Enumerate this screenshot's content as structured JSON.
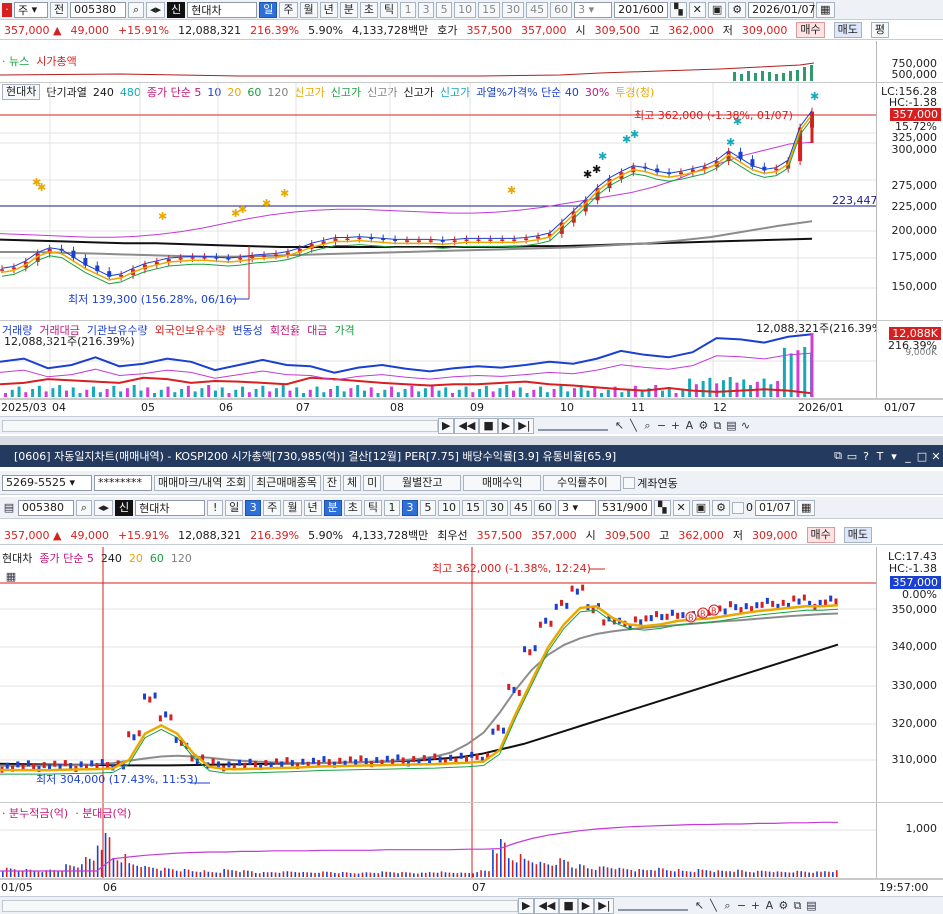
{
  "top": {
    "toolbar": {
      "period_type": "주",
      "scope": "전",
      "code": "005380",
      "stock_badge": "신",
      "stock_name": "현대차",
      "periods": [
        "일",
        "주",
        "월",
        "년",
        "분",
        "초",
        "틱"
      ],
      "numbers": [
        "1",
        "3",
        "5",
        "10",
        "15",
        "30",
        "45",
        "60"
      ],
      "interval": "3",
      "count": "201/600",
      "date": "2026/01/07"
    },
    "quote": {
      "price": "357,000",
      "change": "49,000",
      "pct": "+15.91%",
      "volume": "12,088,321",
      "vol_ratio": "216.39%",
      "turnover": "5.90%",
      "amount": "4,133,728백만",
      "ask_label": "호가",
      "ask1": "357,500",
      "ask2": "357,000",
      "open_label": "시",
      "open": "309,500",
      "high_label": "고",
      "high": "362,000",
      "low_label": "저",
      "low": "309,000",
      "buy": "매수",
      "sell": "매도",
      "eval": "평"
    },
    "news_legend": [
      "뉴스",
      "시가총액"
    ],
    "news_axis": [
      "750,000",
      "500,000"
    ],
    "price_legend": {
      "name": "현대차",
      "items": [
        {
          "text": "단기과열",
          "color": "#1a1a1a"
        },
        {
          "text": "240",
          "color": "#1a1a1a"
        },
        {
          "text": "480",
          "color": "#18a8b8"
        },
        {
          "text": "종가 단순 5",
          "color": "#c0157a"
        },
        {
          "text": "10",
          "color": "#1a3fd1"
        },
        {
          "text": "20",
          "color": "#e8a900"
        },
        {
          "text": "60",
          "color": "#18a040"
        },
        {
          "text": "120",
          "color": "#808080"
        },
        {
          "text": "신고가",
          "color": "#e8a900"
        },
        {
          "text": "신고가",
          "color": "#18a040"
        },
        {
          "text": "신고가",
          "color": "#808080"
        },
        {
          "text": "신고가",
          "color": "#1a1a1a"
        },
        {
          "text": "신고가",
          "color": "#18a8b8"
        },
        {
          "text": "과열%가격% 단순 40",
          "color": "#1a3fd1"
        },
        {
          "text": "30%",
          "color": "#c0157a"
        },
        {
          "text": "투경(청)",
          "color": "#e8a900"
        }
      ]
    },
    "price_axis": [
      "325,000",
      "300,000",
      "275,000",
      "250,000",
      "225,000",
      "200,000",
      "175,000",
      "150,000"
    ],
    "price_tags": {
      "lc": "LC:156.28",
      "hc": "HC:-1.38",
      "last": "357,000",
      "pct": "15.72%",
      "ref": "223,447"
    },
    "high_note": "최고 362,000 (-1.38%, 01/07)",
    "low_note": "최저 139,300 (156.28%, 06/16)",
    "volume_legend": [
      {
        "text": "거래량",
        "color": "#1a3fd1"
      },
      {
        "text": "거래대금",
        "color": "#c0157a"
      },
      {
        "text": "기관보유수량",
        "color": "#1a3fd1"
      },
      {
        "text": "외국인보유수량",
        "color": "#d71f1f"
      },
      {
        "text": "변동성",
        "color": "#1a3fd1"
      },
      {
        "text": "회전율",
        "color": "#c0157a"
      },
      {
        "text": "대금",
        "color": "#c0157a"
      },
      {
        "text": "가격",
        "color": "#18a040"
      }
    ],
    "volume_note_left": "12,088,321주(216.39%)",
    "volume_note_right": "12,088,321주(216.39%)",
    "volume_tags": {
      "a": "12,088K",
      "b": "216.39%",
      "c": "9,000K"
    },
    "x_labels": [
      "2025/03",
      "04",
      "05",
      "06",
      "07",
      "08",
      "09",
      "10",
      "11",
      "12",
      "2026/01",
      "01/07"
    ],
    "series": {
      "daily_close": [
        188000,
        190000,
        196000,
        205000,
        210000,
        208000,
        200000,
        192000,
        186000,
        180000,
        182000,
        188000,
        193000,
        196000,
        199000,
        200000,
        201000,
        201000,
        200000,
        199000,
        200000,
        202000,
        203000,
        204000,
        206000,
        210000,
        215000,
        218000,
        221000,
        221000,
        222000,
        221000,
        220000,
        219000,
        219000,
        219000,
        219000,
        218000,
        219000,
        220000,
        220000,
        220000,
        220000,
        220000,
        221000,
        223000,
        226000,
        238000,
        250000,
        262000,
        275000,
        285000,
        292000,
        298000,
        296000,
        292000,
        290000,
        292000,
        295000,
        298000,
        304000,
        314000,
        306000,
        298000,
        294000,
        296000,
        304000,
        340000,
        357000
      ],
      "ma_upper": [
        222000,
        221000,
        220000,
        219000,
        218000,
        218000,
        219000,
        221000,
        224000,
        228000,
        233000,
        238000,
        242000,
        245000,
        247000,
        248000,
        248000,
        247000,
        246000,
        245000,
        244000,
        244000,
        245000,
        247000,
        250000,
        254000,
        258000,
        262000,
        266000,
        272000,
        280000,
        290000,
        298000,
        306000,
        312000,
        318000,
        320000
      ],
      "ma_black": [
        222000,
        221000,
        220000,
        219000,
        218000,
        218000,
        217000,
        216000,
        215000,
        214000,
        214000,
        214000,
        214000,
        214000,
        214000,
        214000,
        214000,
        215000,
        215000,
        216000,
        217000,
        218000,
        219000,
        220000,
        221000,
        222000,
        223000
      ],
      "ma_gray": [
        213000,
        213000,
        212000,
        211000,
        210000,
        209000,
        208000,
        208000,
        209000,
        210000,
        211000,
        212000,
        213000,
        214000,
        215000,
        216000,
        217000,
        218000,
        220000,
        222000,
        225000,
        229000,
        235000,
        241000,
        246000
      ],
      "vol_blue": [
        0.55,
        0.6,
        0.45,
        0.5,
        0.62,
        0.48,
        0.52,
        0.6,
        0.55,
        0.42,
        0.5,
        0.58,
        0.5,
        0.48,
        0.38,
        0.46,
        0.5,
        0.44,
        0.4,
        0.45,
        0.48,
        0.46,
        0.5,
        0.55,
        0.52,
        0.6,
        0.72,
        0.66,
        0.62,
        0.7,
        0.92,
        0.9,
        0.85,
        0.94,
        0.98
      ],
      "vol_red": [
        0.2,
        0.22,
        0.28,
        0.26,
        0.24,
        0.22,
        0.3,
        0.28,
        0.22,
        0.25,
        0.24,
        0.22,
        0.2,
        0.3,
        0.28,
        0.25,
        0.22,
        0.2,
        0.18,
        0.2,
        0.2,
        0.22,
        0.24,
        0.2,
        0.18,
        0.15,
        0.12,
        0.1,
        0.14,
        0.1,
        0.08,
        0.1,
        0.12,
        0.1,
        0.06
      ]
    }
  },
  "bottom": {
    "title": "[0606] 자동일지차트(매매내역) - KOSPI200 시가총액[730,985(억)] 결산[12월] PER[7.75] 배당수익률[3.9] 유통비율[65.9]",
    "toolbar": {
      "account": "5269-5525",
      "password": "********",
      "btn1": "매매마크/내역 조회",
      "btn2": "최근매매종목",
      "chk": [
        "잔",
        "체",
        "미"
      ],
      "btn3": "월별잔고",
      "btn4": "매매수익",
      "btn5": "수익률추이",
      "link_label": "계좌연동"
    },
    "toolbar2": {
      "code": "005380",
      "stock_badge": "신",
      "stock_name": "현대차",
      "excl": "!",
      "periods": [
        "일",
        "3",
        "주",
        "월",
        "년",
        "분",
        "초",
        "틱"
      ],
      "numbers": [
        "1",
        "3",
        "5",
        "10",
        "15",
        "30",
        "45",
        "60"
      ],
      "interval": "3",
      "count": "531/900",
      "zero": "0",
      "date": "01/07"
    },
    "quote": {
      "price": "357,000",
      "change": "49,000",
      "pct": "+15.91%",
      "volume": "12,088,321",
      "vol_ratio": "216.39%",
      "turnover": "5.90%",
      "amount": "4,133,728백만",
      "ask_label": "최우선",
      "ask1": "357,500",
      "ask2": "357,000",
      "open_label": "시",
      "open": "309,500",
      "high_label": "고",
      "high": "362,000",
      "low_label": "저",
      "low": "309,000",
      "buy": "매수",
      "sell": "매도"
    },
    "legend": [
      {
        "text": "현대차",
        "color": "#1a1a1a"
      },
      {
        "text": "종가 단순 5",
        "color": "#c0157a"
      },
      {
        "text": "240",
        "color": "#1a1a1a"
      },
      {
        "text": "20",
        "color": "#e8a900"
      },
      {
        "text": "60",
        "color": "#18a040"
      },
      {
        "text": "120",
        "color": "#808080"
      }
    ],
    "price_axis": [
      "350,000",
      "340,000",
      "330,000",
      "320,000",
      "310,000"
    ],
    "tags": {
      "lc": "LC:17.43",
      "hc": "HC:-1.38",
      "last": "357,000",
      "pct": "0.00%"
    },
    "high_note": "최고 362,000 (-1.38%, 12:24)",
    "low_note": "최저 304,000 (17.43%, 11:53)",
    "volume_legend": [
      "분누적금(억)",
      "분대금(억)"
    ],
    "volume_axis": [
      "1,000"
    ],
    "x_labels": [
      "01/05",
      "06",
      "07",
      "19:57:00"
    ],
    "series": {
      "intraday_close": [
        306800,
        306900,
        307000,
        307100,
        307000,
        307200,
        307300,
        307500,
        316000,
        328000,
        322000,
        314000,
        309000,
        307500,
        307200,
        307400,
        307600,
        307800,
        307900,
        308000,
        308200,
        308300,
        308400,
        308500,
        308600,
        308700,
        308800,
        309000,
        309200,
        309500,
        309800,
        318000,
        330000,
        342000,
        350000,
        356000,
        360000,
        355000,
        351000,
        350000,
        351000,
        352000,
        353000,
        352000,
        353000,
        354000,
        355000,
        355000,
        356000,
        356000,
        357000,
        356000,
        357000
      ],
      "ma_yellow": [
        307000,
        307000,
        307000,
        307000,
        307100,
        307200,
        307300,
        307500,
        310000,
        318000,
        320500,
        318000,
        312000,
        308000,
        307300,
        307300,
        307400,
        307600,
        307700,
        307900,
        308100,
        308200,
        308300,
        308400,
        308500,
        308600,
        308700,
        308800,
        309000,
        309200,
        309600,
        313000,
        324000,
        334000,
        344000,
        351000,
        356000,
        356500,
        353000,
        351000,
        350500,
        351000,
        352000,
        352500,
        352800,
        353500,
        354300,
        355000,
        355500,
        356000,
        356500,
        356500,
        356800
      ],
      "ma_black": [
        308000,
        307900,
        307800,
        307700,
        307700,
        307600,
        307500,
        307500,
        307500,
        307600,
        307700,
        307800,
        307900,
        308000,
        308100,
        308200,
        308300,
        308400,
        308600,
        308800,
        309000,
        309500,
        310000,
        311000,
        312500,
        314000,
        316000,
        318000,
        320000,
        322000,
        324000,
        326000,
        328000,
        330000,
        332000,
        334000,
        336000,
        338000,
        340000,
        342000,
        344000
      ],
      "ma_gray": [
        308000,
        308000,
        308000,
        308100,
        308100,
        308200,
        308400,
        308800,
        309500,
        310200,
        310800,
        311000,
        310800,
        310400,
        309900,
        309500,
        309200,
        309000,
        308900,
        308800,
        308800,
        308900,
        309000,
        309200,
        309400,
        309700,
        310100,
        310800,
        312000,
        314500,
        318000,
        324000,
        331000,
        337000,
        341500,
        344500,
        346500,
        347800,
        348600,
        349200,
        349700,
        350100,
        350500,
        350900,
        351300,
        351700,
        352000,
        352400,
        352800,
        353200,
        353500,
        353800,
        354000
      ],
      "bars": [
        0.12,
        0.1,
        0.08,
        0.1,
        0.18,
        0.3,
        0.7,
        0.35,
        0.22,
        0.15,
        0.12,
        0.1,
        0.08,
        0.06,
        0.1,
        0.08,
        0.05,
        0.06,
        0.07,
        0.05,
        0.06,
        0.05,
        0.04,
        0.05,
        0.06,
        0.05,
        0.04,
        0.06,
        0.05,
        0.04,
        0.08,
        0.6,
        0.35,
        0.3,
        0.22,
        0.28,
        0.18,
        0.14,
        0.16,
        0.12,
        0.1,
        0.12,
        0.1,
        0.08,
        0.1,
        0.08,
        0.09,
        0.07,
        0.08,
        0.06,
        0.07,
        0.06,
        0.08
      ],
      "cum_line": [
        0.0,
        0.0,
        0.0,
        0.0,
        0.0,
        0.0,
        0.0,
        0.22,
        0.25,
        0.28,
        0.3,
        0.32,
        0.33,
        0.34,
        0.34,
        0.35,
        0.35,
        0.36,
        0.36,
        0.36,
        0.37,
        0.37,
        0.37,
        0.37,
        0.38,
        0.38,
        0.38,
        0.38,
        0.38,
        0.39,
        0.39,
        0.4,
        0.5,
        0.58,
        0.64,
        0.68,
        0.72,
        0.75,
        0.77,
        0.79,
        0.8,
        0.81,
        0.82,
        0.83,
        0.83,
        0.84,
        0.84,
        0.85,
        0.85,
        0.86,
        0.86,
        0.87,
        0.87
      ]
    }
  }
}
